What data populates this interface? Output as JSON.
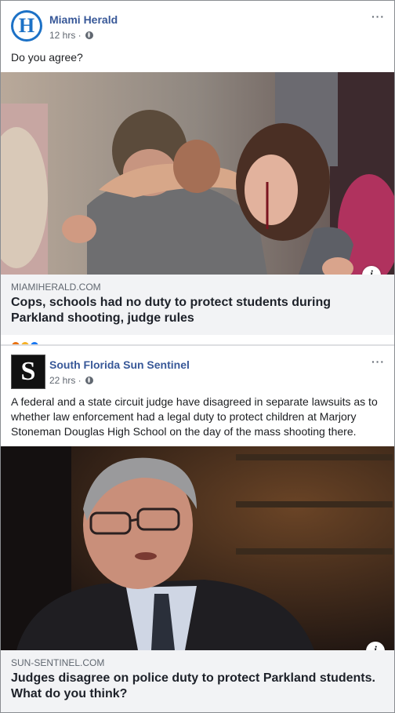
{
  "posts": [
    {
      "page_name": "Miami Herald",
      "time": "12 hrs ·",
      "avatar_letter": "H",
      "caption": "Do you agree?",
      "link": {
        "domain": "MIAMIHERALD.COM",
        "title": "Cops, schools had no duty to protect students during Parkland shooting, judge rules"
      },
      "info_label": "i",
      "more_label": "···"
    },
    {
      "page_name": "South Florida Sun Sentinel",
      "time": "22 hrs ·",
      "avatar_letter": "S",
      "caption": "A federal and a state circuit judge have disagreed in separate lawsuits as to whether law enforcement had a legal duty to protect children at Marjory Stoneman Douglas High School on the day of the mass shooting there.",
      "link": {
        "domain": "SUN-SENTINEL.COM",
        "title": "Judges disagree on police duty to protect Parkland students. What do you think?"
      },
      "info_label": "i",
      "more_label": "···"
    }
  ],
  "colors": {
    "page_name": "#385898",
    "meta_text": "#606770",
    "link_box_bg": "#f2f3f5",
    "herald_blue": "#1c71c6",
    "sentinel_black": "#111111"
  },
  "icons": [
    "globe-icon",
    "more-options-icon",
    "info-icon"
  ]
}
